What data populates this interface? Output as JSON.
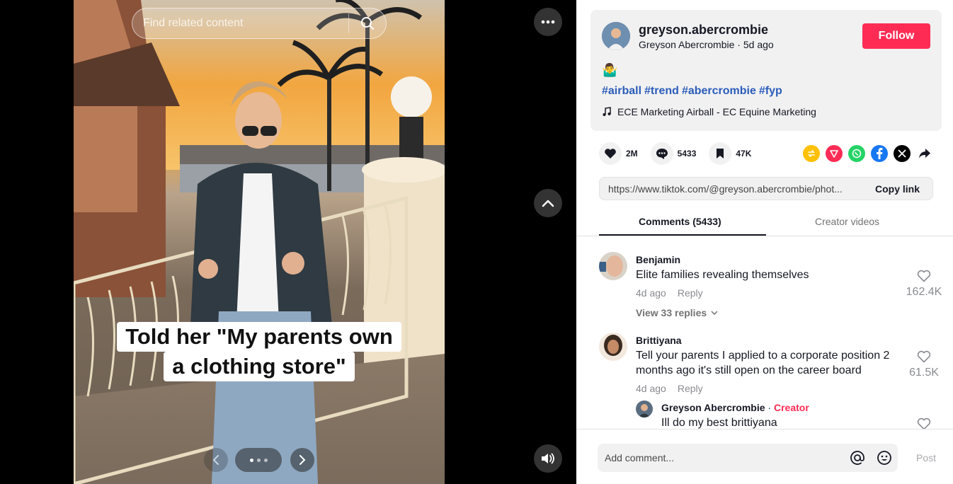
{
  "search": {
    "placeholder": "Find related content"
  },
  "caption": {
    "line1": "Told her \"My parents own",
    "line2": "a clothing store\""
  },
  "carousel": {
    "dot_count": 3,
    "active_index": 0
  },
  "author": {
    "username": "greyson.abercrombie",
    "display_name": "Greyson Abercrombie",
    "separator": " · ",
    "posted": "5d ago",
    "follow_label": "Follow"
  },
  "post": {
    "emoji": "🤷‍♂️",
    "hashtags": [
      "#airball",
      "#trend",
      "#abercrombie",
      "#fyp"
    ],
    "music": "ECE Marketing Airball - EC Equine Marketing"
  },
  "stats": {
    "likes": "2M",
    "comments": "5433",
    "saves": "47K"
  },
  "share_icons": [
    "repost-icon",
    "tiktok-share-icon",
    "whatsapp-icon",
    "facebook-icon",
    "x-icon",
    "share-arrow-icon"
  ],
  "link": {
    "url": "https://www.tiktok.com/@greyson.abercrombie/phot...",
    "copy_label": "Copy link"
  },
  "tabs": {
    "comments": "Comments (5433)",
    "creator": "Creator videos"
  },
  "comments": [
    {
      "name": "Benjamin",
      "text": "Elite families revealing themselves",
      "time": "4d ago",
      "reply": "Reply",
      "likes": "162.4K",
      "view_replies": "View 33 replies"
    },
    {
      "name": "Brittiyana",
      "text": "Tell your parents I applied to a corporate position 2 months ago it's still open on the career board",
      "time": "4d ago",
      "reply": "Reply",
      "likes": "61.5K"
    }
  ],
  "creator_reply": {
    "name": "Greyson Abercrombie",
    "separator": " · ",
    "tag": "Creator",
    "text": "Ill do my best brittiyana"
  },
  "footer": {
    "placeholder": "Add comment...",
    "post_label": "Post"
  },
  "colors": {
    "accent": "#fe2c55",
    "hashtag": "#2b5db9",
    "panel_gray": "#f1f1f2"
  }
}
